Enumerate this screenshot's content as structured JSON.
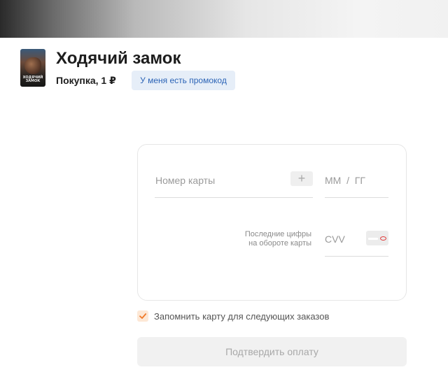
{
  "movie": {
    "title": "Ходячий замок",
    "purchase_label": "Покупка, 1 ₽",
    "poster_text": "ХОДЯЧИЙ ЗАМОК"
  },
  "promo": {
    "label": "У меня есть промокод"
  },
  "card_form": {
    "card_number_placeholder": "Номер карты",
    "scan_button_glyph": "+",
    "expiry_placeholder": "ММ  /  ГГ",
    "cvv_hint_line1": "Последние цифры",
    "cvv_hint_line2": "на обороте карты",
    "cvv_placeholder": "CVV"
  },
  "remember_card": {
    "label": "Запомнить карту для следующих заказов",
    "checked": true
  },
  "confirm": {
    "label": "Подтвердить оплату",
    "enabled": false
  },
  "colors": {
    "promo_text": "#2b63b6",
    "promo_bg": "#e6eef8",
    "checkbox_accent": "#f07a2a",
    "cvv_mark": "#e03a3a"
  },
  "icons": {
    "scan": "plus-icon",
    "cvv": "card-back-icon",
    "checkbox": "checkmark-icon"
  }
}
